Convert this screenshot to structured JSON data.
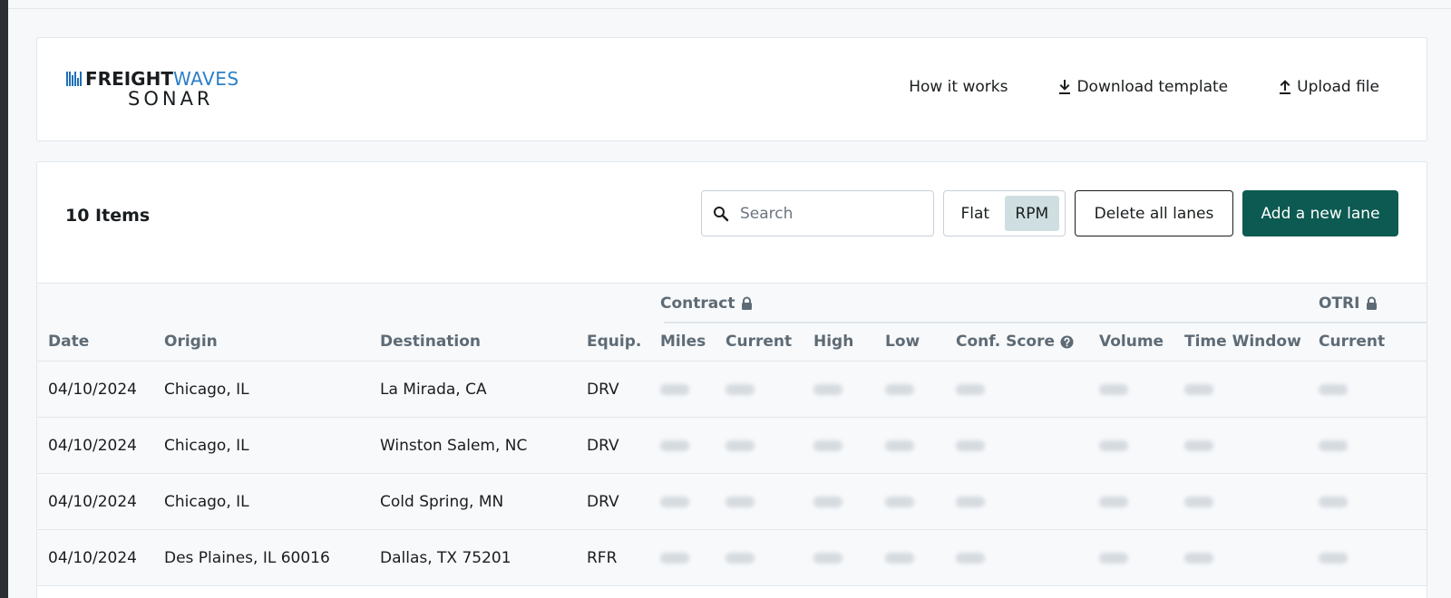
{
  "header": {
    "logo": {
      "brand_bold": "FREIGHT",
      "brand_light": "WAVES",
      "product": "SONAR"
    },
    "actions": [
      {
        "label": "How it works",
        "icon": "none"
      },
      {
        "label": "Download template",
        "icon": "download-icon"
      },
      {
        "label": "Upload file",
        "icon": "upload-icon"
      }
    ]
  },
  "toolbar": {
    "items_count": "10 Items",
    "search": {
      "placeholder": "Search",
      "value": ""
    },
    "rate_toggle": {
      "options": [
        "Flat",
        "RPM"
      ],
      "selected": "RPM"
    },
    "delete_label": "Delete all lanes",
    "add_label": "Add a new lane"
  },
  "table": {
    "groups": {
      "contract": "Contract",
      "otri": "OTRI"
    },
    "columns": {
      "date": "Date",
      "origin": "Origin",
      "destination": "Destination",
      "equip": "Equip.",
      "miles": "Miles",
      "current": "Current",
      "high": "High",
      "low": "Low",
      "conf_score": "Conf. Score",
      "volume": "Volume",
      "time_window": "Time Window",
      "otri_current": "Current"
    },
    "rows": [
      {
        "date": "04/10/2024",
        "origin": "Chicago, IL",
        "destination": "La Mirada, CA",
        "equip": "DRV"
      },
      {
        "date": "04/10/2024",
        "origin": "Chicago, IL",
        "destination": "Winston Salem, NC",
        "equip": "DRV"
      },
      {
        "date": "04/10/2024",
        "origin": "Chicago, IL",
        "destination": "Cold Spring, MN",
        "equip": "DRV"
      },
      {
        "date": "04/10/2024",
        "origin": "Des Plaines, IL 60016",
        "destination": "Dallas, TX 75201",
        "equip": "RFR"
      }
    ]
  },
  "colors": {
    "primary": "#0c5a51",
    "toggle_selected": "#cfdfe1",
    "logo_blue": "#2a7fc6",
    "header_text": "#5e6b75"
  }
}
